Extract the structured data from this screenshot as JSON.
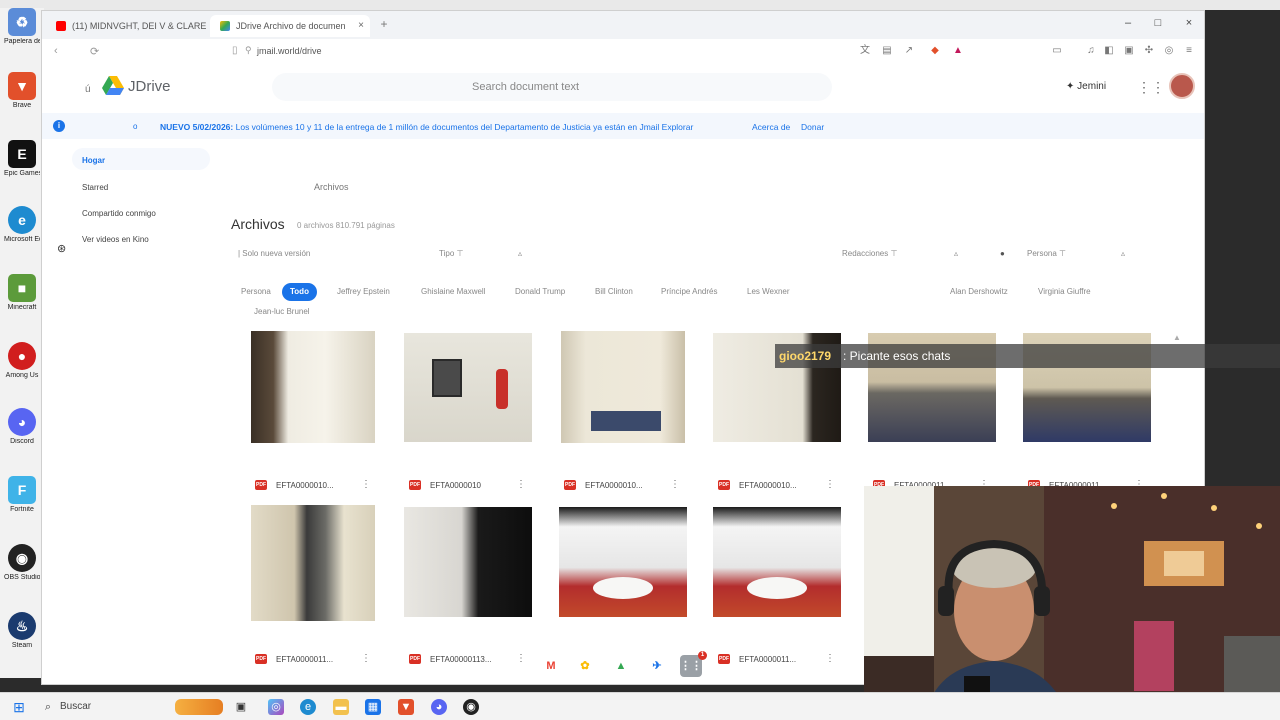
{
  "browser": {
    "tabs": [
      {
        "label": "(11) MIDNVGHT, DEI V & CLARE",
        "active": false
      },
      {
        "label": "JDrive    Archivo de documen",
        "active": true
      }
    ],
    "new_tab_symbol": "+",
    "url": "jmail.world/drive",
    "window_controls": {
      "minimize": "–",
      "maximize": "□",
      "close": "×"
    }
  },
  "app": {
    "logo": "JDrive",
    "search_placeholder": "Search document text",
    "gemini_label": "Jemini",
    "banner": {
      "info_symbol": "i",
      "marker": "o",
      "text_bold": "NUEVO 5/02/2026:",
      "text": "Los volúmenes 10 y 11 de la entrega de 1 millón de documentos del Departamento de Justicia ya están en Jmail Explorar",
      "link_about": "Acerca de",
      "link_donate": "Donar"
    },
    "sidebar": [
      {
        "label": "Hogar",
        "active": true
      },
      {
        "label": "Starred",
        "active": false
      },
      {
        "label": "Compartido conmigo",
        "active": false
      },
      {
        "label": "Ver videos en Kino",
        "active": false
      }
    ],
    "breadcrumb": "Archivos",
    "title": "Archivos",
    "subtitle": "0 archivos  810.791 páginas",
    "filters": {
      "new_version": "| Solo nueva versión",
      "type": "Tipo",
      "redactions": "Redacciones",
      "person": "Persona"
    },
    "chips": [
      "Persona",
      "Todo",
      "Jeffrey Epstein",
      "Ghislaine Maxwell",
      "Donald Trump",
      "Bill Clinton",
      "Príncipe Andrés",
      "Les Wexner",
      "Alan Dershowitz",
      "Virginia Giuffre",
      "Jean-luc Brunel"
    ],
    "files_row1": [
      "EFTA0000010...",
      "EFTA0000010",
      "EFTA0000010...",
      "EFTA0000010...",
      "EFTA0000011...",
      "EFTA0000011..."
    ],
    "files_row2": [
      "EFTA0000011...",
      "EFTA00000113...",
      "EFTA0000011..."
    ],
    "pdf_badge": "PDF",
    "dock_badge": "1"
  },
  "taskbar": {
    "search": "Buscar"
  },
  "desktop_icons": [
    "Papelera de reciclaje",
    "Brave",
    "Epic Games Launcher",
    "Microsoft Edge",
    "Minecraft",
    "Among Us",
    "Discord",
    "Fortnite",
    "OBS Studio",
    "Steam"
  ],
  "chat": {
    "user": "gioo2179",
    "message": ": Picante esos chats"
  },
  "colors": {
    "accent": "#1a73e8",
    "banner_bg": "#f3f7fd"
  }
}
